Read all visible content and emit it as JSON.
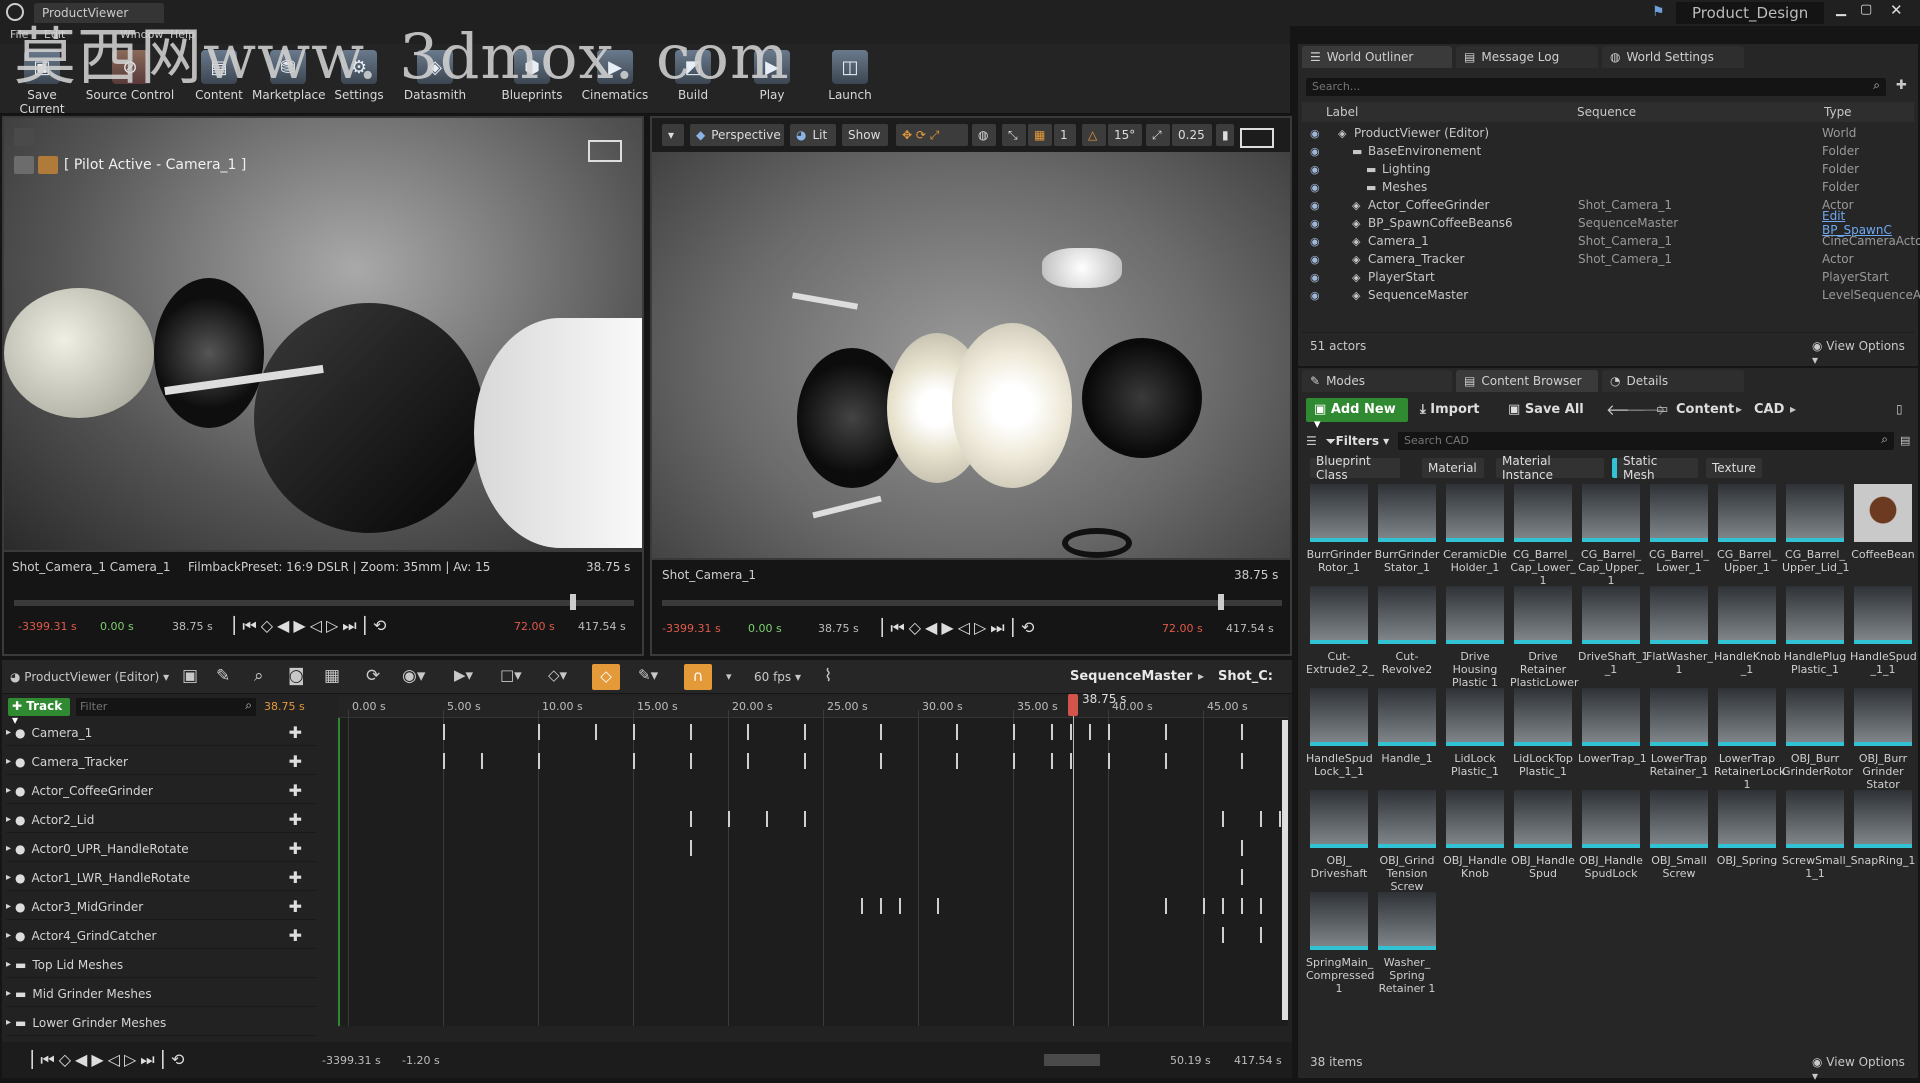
{
  "titlebar": {
    "app_tab": "ProductViewer",
    "project_name": "Product_Design",
    "watermark": "莫西网www. 3dmox. com"
  },
  "menu": {
    "items": [
      "File",
      "Edit",
      "Window",
      "Help"
    ]
  },
  "toolbar": {
    "buttons": [
      "Save Current",
      "Source Control",
      "Content",
      "Marketplace",
      "Settings",
      "Datasmith",
      "Blueprints",
      "Cinematics",
      "Build",
      "Play",
      "Launch"
    ]
  },
  "viewport_left": {
    "pilot_label": "[ Pilot Active - Camera_1 ]",
    "shot_info": "Shot_Camera_1  Camera_1",
    "filmback": "FilmbackPreset: 16:9 DSLR | Zoom: 35mm | Av: 15",
    "time": "38.75  s",
    "playback": {
      "start": "-3399.31 s",
      "t0": "0.00 s",
      "current": "38.75 s",
      "end_red": "72.00 s",
      "end": "417.54 s"
    }
  },
  "viewport_right": {
    "toolbar": {
      "perspective": "Perspective",
      "lit": "Lit",
      "show": "Show",
      "angle": "15°",
      "scale": "0.25"
    },
    "shot_info": "Shot_Camera_1",
    "time": "38.75  s",
    "playback": {
      "start": "-3399.31 s",
      "t0": "0.00 s",
      "current": "38.75 s",
      "end_red": "72.00 s",
      "end": "417.54 s"
    }
  },
  "outliner": {
    "tabs": [
      "World Outliner",
      "Message Log",
      "World Settings"
    ],
    "search_placeholder": "Search...",
    "columns": [
      "Label",
      "Sequence",
      "Type"
    ],
    "rows": [
      {
        "label": "ProductViewer (Editor)",
        "sequence": "",
        "type": "World",
        "indent": 0
      },
      {
        "label": "BaseEnvironement",
        "sequence": "",
        "type": "Folder",
        "indent": 1
      },
      {
        "label": "Lighting",
        "sequence": "",
        "type": "Folder",
        "indent": 2
      },
      {
        "label": "Meshes",
        "sequence": "",
        "type": "Folder",
        "indent": 2
      },
      {
        "label": "Actor_CoffeeGrinder",
        "sequence": "Shot_Camera_1",
        "type": "Actor",
        "indent": 1
      },
      {
        "label": "BP_SpawnCoffeeBeans6",
        "sequence": "SequenceMaster",
        "type": "Edit BP_SpawnC",
        "indent": 1
      },
      {
        "label": "Camera_1",
        "sequence": "Shot_Camera_1",
        "type": "CineCameraActor",
        "indent": 1
      },
      {
        "label": "Camera_Tracker",
        "sequence": "Shot_Camera_1",
        "type": "Actor",
        "indent": 1
      },
      {
        "label": "PlayerStart",
        "sequence": "",
        "type": "PlayerStart",
        "indent": 1
      },
      {
        "label": "SequenceMaster",
        "sequence": "",
        "type": "LevelSequenceAct",
        "indent": 1
      }
    ],
    "actor_count": "51 actors",
    "view_options": "View Options"
  },
  "content_browser": {
    "tabs": [
      "Modes",
      "Content Browser",
      "Details"
    ],
    "add_new": "Add New",
    "import": "Import",
    "save_all": "Save All",
    "path": [
      "Content",
      "CAD"
    ],
    "filters": "Filters",
    "search_placeholder": "Search CAD",
    "filter_chips": [
      "Blueprint Class",
      "Material",
      "Material Instance",
      "Static Mesh",
      "Texture"
    ],
    "assets": [
      "BurrGrinder Rotor_1",
      "BurrGrinder Stator_1",
      "CeramicDie Holder_1",
      "CG_Barrel_ Cap_Lower_ 1",
      "CG_Barrel_ Cap_Upper_ 1",
      "CG_Barrel_ Lower_1",
      "CG_Barrel_ Upper_1",
      "CG_Barrel_ Upper_Lid_1",
      "CoffeeBean",
      "Cut- Extrude2_2_",
      "Cut-Revolve2",
      "Drive Housing Plastic 1",
      "Drive Retainer PlasticLower",
      "DriveShaft_1 _1",
      "FlatWasher_ 1",
      "HandleKnob _1",
      "HandlePlug Plastic_1",
      "HandleSpud _1_1",
      "HandleSpud Lock_1_1",
      "Handle_1",
      "LidLock Plastic_1",
      "LidLockTop Plastic_1",
      "LowerTrap_1",
      "LowerTrap Retainer_1",
      "LowerTrap RetainerLock 1",
      "OBJ_Burr GrinderRotor",
      "OBJ_Burr Grinder Stator",
      "OBJ_ Driveshaft",
      "OBJ_Grind Tension Screw",
      "OBJ_Handle Knob",
      "OBJ_Handle Spud",
      "OBJ_Handle SpudLock",
      "OBJ_Small Screw",
      "OBJ_Spring",
      "ScrewSmall_ 1_1",
      "SnapRing_1",
      "SpringMain_ Compressed 1",
      "Washer_ Spring Retainer 1"
    ],
    "item_count": "38 items",
    "view_options": "View Options"
  },
  "sequencer": {
    "world": "ProductViewer (Editor)",
    "fps": "60 fps",
    "breadcrumb": [
      "SequenceMaster",
      "Shot_C:"
    ],
    "track_button": "Track",
    "filter_placeholder": "Filter",
    "current_time": "38.75 s",
    "playhead_label": "38.75 s",
    "ruler": [
      "0.00 s",
      "5.00 s",
      "10.00 s",
      "15.00 s",
      "20.00 s",
      "25.00 s",
      "30.00 s",
      "35.00 s",
      "40.00 s",
      "45.00 s"
    ],
    "tracks": [
      "Camera_1",
      "Camera_Tracker",
      "Actor_CoffeeGrinder",
      "Actor2_Lid",
      "Actor0_UPR_HandleRotate",
      "Actor1_LWR_HandleRotate",
      "Actor3_MidGrinder",
      "Actor4_GrindCatcher",
      "Top Lid Meshes",
      "Mid Grinder Meshes",
      "Lower Grinder Meshes"
    ],
    "bottom": {
      "start": "-3399.31 s",
      "view_start": "-1.20 s",
      "view_end": "50.19 s",
      "end": "417.54 s"
    }
  }
}
